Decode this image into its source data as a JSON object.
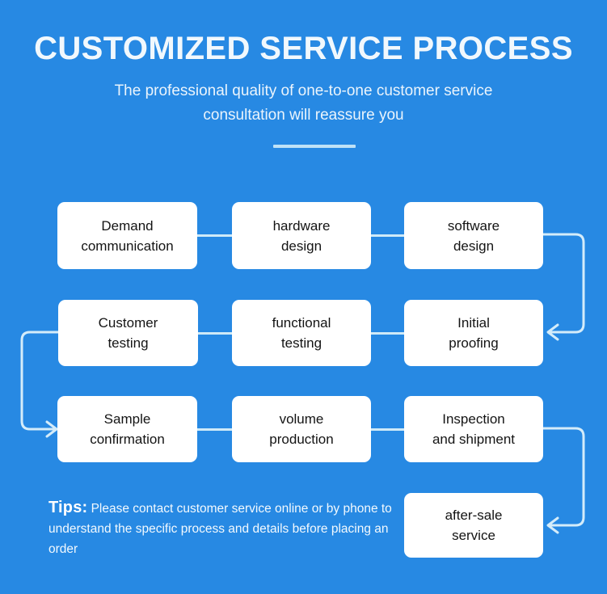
{
  "header": {
    "title": "CUSTOMIZED SERVICE PROCESS",
    "subtitle": "The professional quality of one-to-one customer service consultation will reassure you"
  },
  "colors": {
    "background": "#2789e3",
    "box_fill": "#ffffff",
    "box_text": "#141414",
    "connector": "#d4ecfa",
    "header_text": "#f1f8fd",
    "divider": "#bfe2f7"
  },
  "flow": {
    "rows": [
      {
        "steps": [
          {
            "label": "Demand\ncommunication"
          },
          {
            "label": "hardware\ndesign"
          },
          {
            "label": "software\ndesign"
          }
        ]
      },
      {
        "steps": [
          {
            "label": "Customer\ntesting"
          },
          {
            "label": "functional\ntesting"
          },
          {
            "label": "Initial\nproofing"
          }
        ]
      },
      {
        "steps": [
          {
            "label": "Sample\nconfirmation"
          },
          {
            "label": "volume\nproduction"
          },
          {
            "label": "Inspection\nand shipment"
          }
        ]
      },
      {
        "steps": [
          {
            "label": "after-sale\nservice"
          }
        ]
      }
    ],
    "connectors": [
      {
        "name": "software-design-to-initial-proofing",
        "direction": "right-down-left",
        "arrow": "left"
      },
      {
        "name": "customer-testing-to-sample-confirmation",
        "direction": "left-down-right",
        "arrow": "right"
      },
      {
        "name": "inspection-to-after-sale-service",
        "direction": "right-down-left",
        "arrow": "left"
      }
    ]
  },
  "tips": {
    "label": "Tips:",
    "body": "Please contact customer service online or by phone to understand the specific process and details before placing an order"
  }
}
